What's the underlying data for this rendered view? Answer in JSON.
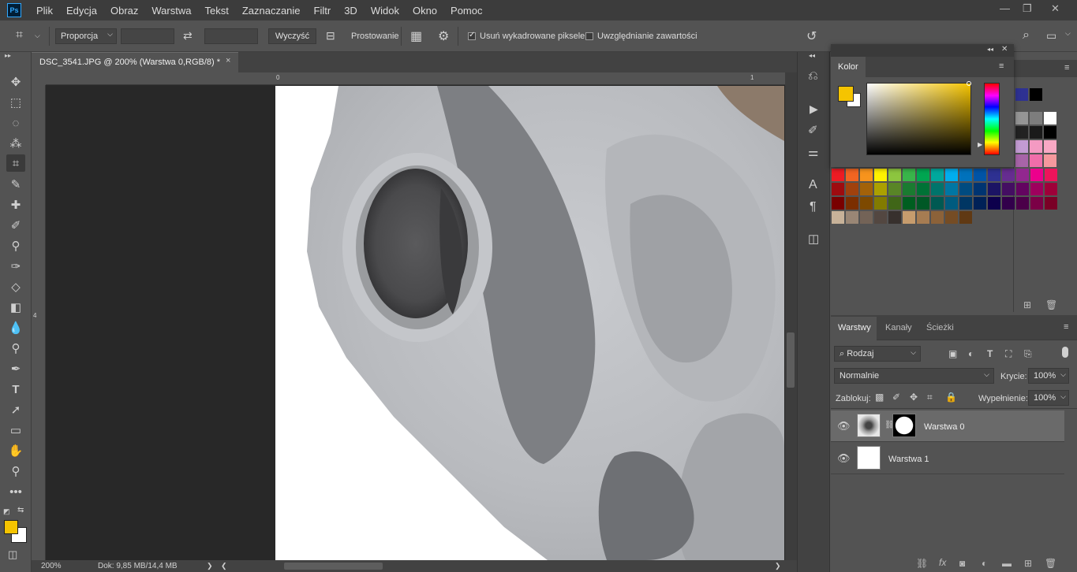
{
  "app": {
    "logo": "Ps"
  },
  "menu": [
    "Plik",
    "Edycja",
    "Obraz",
    "Warstwa",
    "Tekst",
    "Zaznaczanie",
    "Filtr",
    "3D",
    "Widok",
    "Okno",
    "Pomoc"
  ],
  "window_controls": {
    "minimize": "—",
    "restore": "❐",
    "close": "✕"
  },
  "options": {
    "ratio": "Proporcja",
    "ratio_chevron": "⌵",
    "width_value": "",
    "swap_icon": "⇄",
    "height_value": "",
    "clear_button": "Wyczyść",
    "straighten_label": "Prostowanie",
    "delete_cropped_label": "Usuń wykadrowane piksele",
    "delete_cropped_checked": true,
    "content_aware_label": "Uwzględnianie zawartości",
    "content_aware_checked": false
  },
  "document": {
    "tab_title": "DSC_3541.JPG @ 200% (Warstwa 0,RGB/8) *",
    "tab_close": "×",
    "ruler_top_zero": "0",
    "ruler_top_one": "1",
    "ruler_left_four": "4"
  },
  "status": {
    "zoom": "200%",
    "doc_info": "Dok: 9,85 MB/14,4 MB",
    "arrow": "❯",
    "scroll_left": "❮",
    "scroll_right": "❯"
  },
  "color_panel": {
    "title": "Kolor",
    "foreground": "#f5c400",
    "background": "#ffffff",
    "collapse": "◂◂",
    "close": "✕",
    "menu": "≡"
  },
  "swatches": {
    "row1": [
      "#ed1c24",
      "#f26522",
      "#f7941d",
      "#fff200",
      "#8dc63f",
      "#39b54a",
      "#00a651",
      "#00a99d",
      "#00aeef",
      "#0072bc",
      "#0054a6",
      "#2e3192",
      "#662d91",
      "#92278f",
      "#ec008c",
      "#ed145b"
    ],
    "row2": [
      "#9e0b0f",
      "#a0410d",
      "#a36209",
      "#aba000",
      "#598527",
      "#1a7b30",
      "#007236",
      "#00746b",
      "#0076a3",
      "#004b80",
      "#003471",
      "#1b1464",
      "#440e62",
      "#630460",
      "#9e005d",
      "#9e0039"
    ],
    "row3": [
      "#790000",
      "#7b2e00",
      "#7d4900",
      "#827b00",
      "#406618",
      "#005e20",
      "#005826",
      "#005952",
      "#005b7f",
      "#003663",
      "#002157",
      "#0d004c",
      "#32004b",
      "#4b0049",
      "#7b0046",
      "#7a0026"
    ],
    "row4": [
      "#c7b299",
      "#998675",
      "#736357",
      "#534741",
      "#37302d",
      "#c69c6d",
      "#a67c52",
      "#8c6239",
      "#754c24",
      "#603913"
    ],
    "top_gray": [
      "#959595",
      "#7d7d7d",
      "#ffffff"
    ],
    "gray_row": [
      "#222222",
      "#1a1a1a",
      "#000000"
    ],
    "pink_a": [
      "#c39bd3",
      "#f49ac2",
      "#f9a8c4"
    ],
    "pink_b": [
      "#a864a8",
      "#f06eaa",
      "#f6989d"
    ],
    "top_dark": [
      "#2e3192",
      "#000000"
    ]
  },
  "layers_panel": {
    "tabs": [
      "Warstwy",
      "Kanały",
      "Ścieżki"
    ],
    "filter_label": "Rodzaj",
    "blend_mode": "Normalnie",
    "opacity_label": "Krycie:",
    "opacity_value": "100%",
    "lock_label": "Zablokuj:",
    "fill_label": "Wypełnienie:",
    "fill_value": "100%",
    "layers": [
      {
        "name": "Warstwa 0",
        "visible": true,
        "selected": true
      },
      {
        "name": "Warstwa 1",
        "visible": true,
        "selected": false
      }
    ]
  }
}
